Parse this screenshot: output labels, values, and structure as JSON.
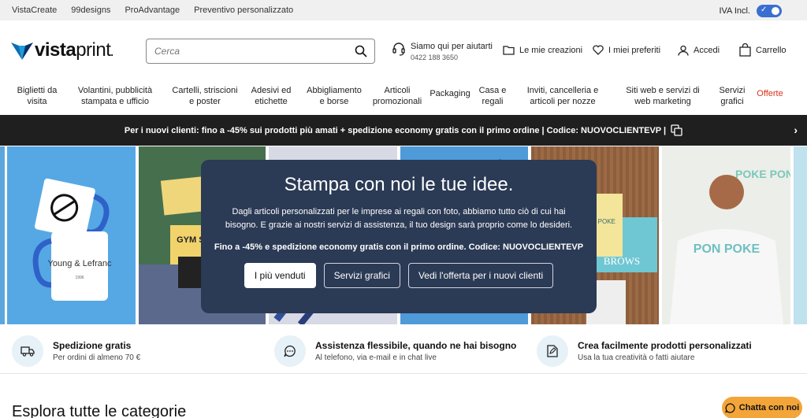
{
  "topbar": {
    "links": [
      "VistaCreate",
      "99designs",
      "ProAdvantage",
      "Preventivo personalizzato"
    ],
    "iva_label": "IVA Incl."
  },
  "header": {
    "logo_text_bold": "vista",
    "logo_text_light": "print",
    "logo_dot": ".",
    "search_placeholder": "Cerca",
    "help_title": "Siamo qui per aiutarti",
    "help_phone": "0422 188 3650",
    "my_creations": "Le mie creazioni",
    "favorites": "I miei preferiti",
    "login": "Accedi",
    "cart": "Carrello"
  },
  "nav": {
    "items": [
      "Biglietti da visita",
      "Volantini, pubblicità stampata e ufficio",
      "Cartelli, striscioni e poster",
      "Adesivi ed etichette",
      "Abbigliamento e borse",
      "Articoli promozionali",
      "Packaging",
      "Casa e regali",
      "Inviti, cancelleria e articoli per nozze",
      "Siti web e servizi di web marketing",
      "Servizi grafici",
      "Offerte"
    ]
  },
  "promo": {
    "text": "Per i nuovi clienti: fino a -45% sui prodotti più amati + spedizione economy gratis con il primo ordine | Codice: NUOVOCLIENTEVP |"
  },
  "hero": {
    "mug_text": "Young & Lefranc",
    "mug_small": "1996",
    "gym_card": "GYM SISTER",
    "tote_text": "PON POKE",
    "bag_text": "BROWS",
    "shirt_text": "PON POKE",
    "bg_text": "POKE PON"
  },
  "overlay": {
    "title": "Stampa con noi le tue idee.",
    "body": "Dagli articoli personalizzati per le imprese ai regali con foto, abbiamo tutto ciò di cui hai bisogno. E grazie ai nostri servizi di assistenza, il tuo design sarà proprio come lo desideri.",
    "offer": "Fino a -45% e spedizione economy gratis con il primo ordine. Codice: NUOVOCLIENTEVP",
    "btn_bestsellers": "I più venduti",
    "btn_design": "Servizi grafici",
    "btn_offer": "Vedi l'offerta per i nuovi clienti"
  },
  "features": [
    {
      "title": "Spedizione gratis",
      "sub": "Per ordini di almeno 70 €"
    },
    {
      "title": "Assistenza flessibile, quando ne hai bisogno",
      "sub": "Al telefono, via e-mail e in chat live"
    },
    {
      "title": "Crea facilmente prodotti personalizzati",
      "sub": "Usa la tua creatività o fatti aiutare"
    }
  ],
  "explore_title": "Esplora tutte le categorie",
  "chat_label": "Chatta con noi"
}
